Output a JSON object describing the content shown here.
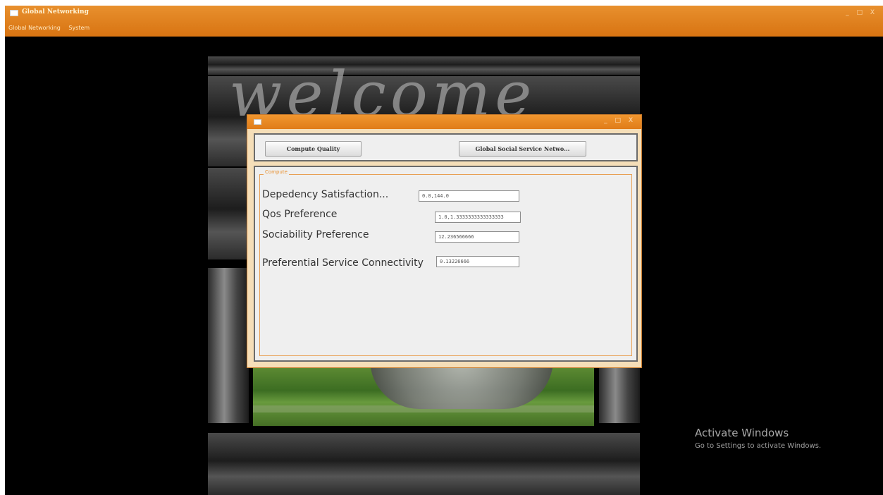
{
  "main_window": {
    "title": "Global Networking",
    "menu": [
      "Global Networking",
      "System"
    ],
    "controls": "_ □ X"
  },
  "background": {
    "script_word": "welcome"
  },
  "dialog": {
    "controls": "_ □ X",
    "buttons": {
      "compute_quality": "Compute Quality",
      "global_social": "Global Social Service Netwo..."
    },
    "group_title": "Compute",
    "fields": [
      {
        "label": "Depedency Satisfaction...",
        "value": "0.0,144.0"
      },
      {
        "label": "Qos Preference",
        "value": "1.0,1.3333333333333333"
      },
      {
        "label": "Sociability Preference",
        "value": "12.236566666"
      },
      {
        "label": "Preferential Service Connectivity",
        "value": "0.13226666"
      }
    ]
  },
  "watermark": {
    "title": "Activate Windows",
    "subtitle": "Go to Settings to activate Windows."
  }
}
